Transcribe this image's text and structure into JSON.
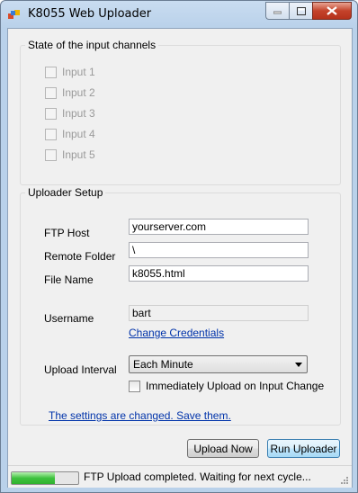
{
  "window": {
    "title": "K8055 Web Uploader"
  },
  "inputs_group": {
    "legend": "State of the input channels",
    "channels": [
      {
        "label": "Input 1",
        "checked": false
      },
      {
        "label": "Input 2",
        "checked": false
      },
      {
        "label": "Input 3",
        "checked": false
      },
      {
        "label": "Input 4",
        "checked": false
      },
      {
        "label": "Input 5",
        "checked": false
      }
    ]
  },
  "setup_group": {
    "legend": "Uploader Setup",
    "ftp_host": {
      "label": "FTP Host",
      "value": "yourserver.com"
    },
    "remote_folder": {
      "label": "Remote Folder",
      "value": "\\"
    },
    "file_name": {
      "label": "File Name",
      "value": "k8055.html"
    },
    "username": {
      "label": "Username",
      "value": "bart"
    },
    "change_credentials": "Change Credentials",
    "upload_interval": {
      "label": "Upload Interval",
      "selected": "Each Minute"
    },
    "immediate_upload": {
      "label": "Immediately Upload on Input Change",
      "checked": false
    },
    "settings_changed_link": "The settings are changed. Save them."
  },
  "actions": {
    "upload_now": "Upload Now",
    "run_uploader": "Run Uploader"
  },
  "status": {
    "text": "FTP Upload completed. Waiting for next cycle...",
    "progress_percent": 65
  }
}
